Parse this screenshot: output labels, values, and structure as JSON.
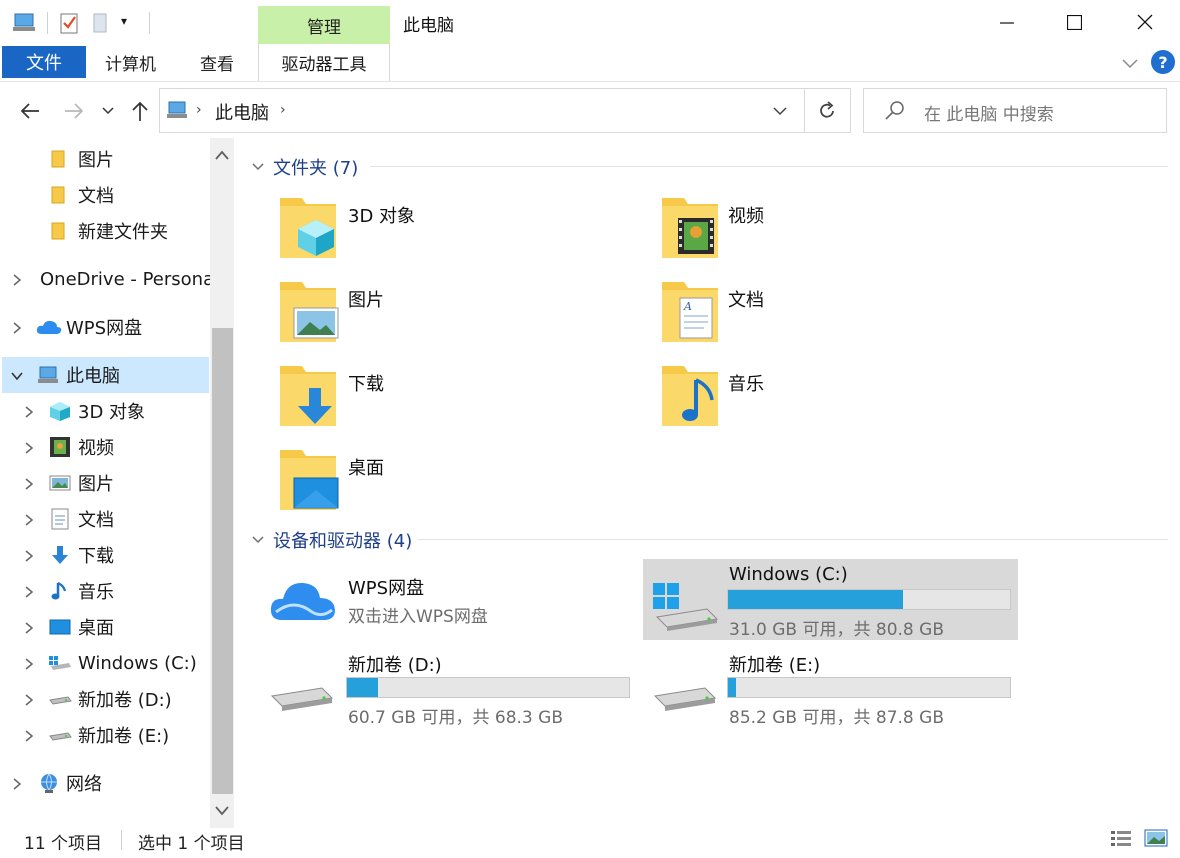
{
  "titlebar": {
    "manage_tab": "管理",
    "title": "此电脑"
  },
  "ribbon": {
    "file": "文件",
    "computer": "计算机",
    "view": "查看",
    "drive_tools": "驱动器工具"
  },
  "address": {
    "location": "此电脑",
    "search_placeholder": "在 此电脑 中搜索"
  },
  "nav": {
    "items": [
      {
        "label": "图片"
      },
      {
        "label": "文档"
      },
      {
        "label": "新建文件夹"
      },
      {
        "label": "OneDrive - Personal"
      },
      {
        "label": "WPS网盘"
      },
      {
        "label": "此电脑"
      },
      {
        "label": "3D 对象"
      },
      {
        "label": "视频"
      },
      {
        "label": "图片"
      },
      {
        "label": "文档"
      },
      {
        "label": "下载"
      },
      {
        "label": "音乐"
      },
      {
        "label": "桌面"
      },
      {
        "label": "Windows (C:)"
      },
      {
        "label": "新加卷 (D:)"
      },
      {
        "label": "新加卷 (E:)"
      },
      {
        "label": "网络"
      }
    ]
  },
  "content": {
    "folders_header": "文件夹 (7)",
    "folders": [
      {
        "label": "3D 对象"
      },
      {
        "label": "视频"
      },
      {
        "label": "图片"
      },
      {
        "label": "文档"
      },
      {
        "label": "下载"
      },
      {
        "label": "音乐"
      },
      {
        "label": "桌面"
      }
    ],
    "devices_header": "设备和驱动器 (4)",
    "drives": [
      {
        "label": "WPS网盘",
        "sub": "双击进入WPS网盘"
      },
      {
        "label": "Windows (C:)",
        "sub": "31.0 GB 可用，共 80.8 GB",
        "used_fraction": 0.62
      },
      {
        "label": "新加卷 (D:)",
        "sub": "60.7 GB 可用，共 68.3 GB",
        "used_fraction": 0.11
      },
      {
        "label": "新加卷 (E:)",
        "sub": "85.2 GB 可用，共 87.8 GB",
        "used_fraction": 0.03
      }
    ]
  },
  "status": {
    "count": "11 个项目",
    "selected": "选中 1 个项目"
  },
  "colors": {
    "accent": "#1a66c4",
    "manage_tab_bg": "#c9f0a9",
    "selection_bg": "#cce8ff",
    "drive_bar_fill": "#26a0da",
    "header_text": "#1e3f8a"
  }
}
